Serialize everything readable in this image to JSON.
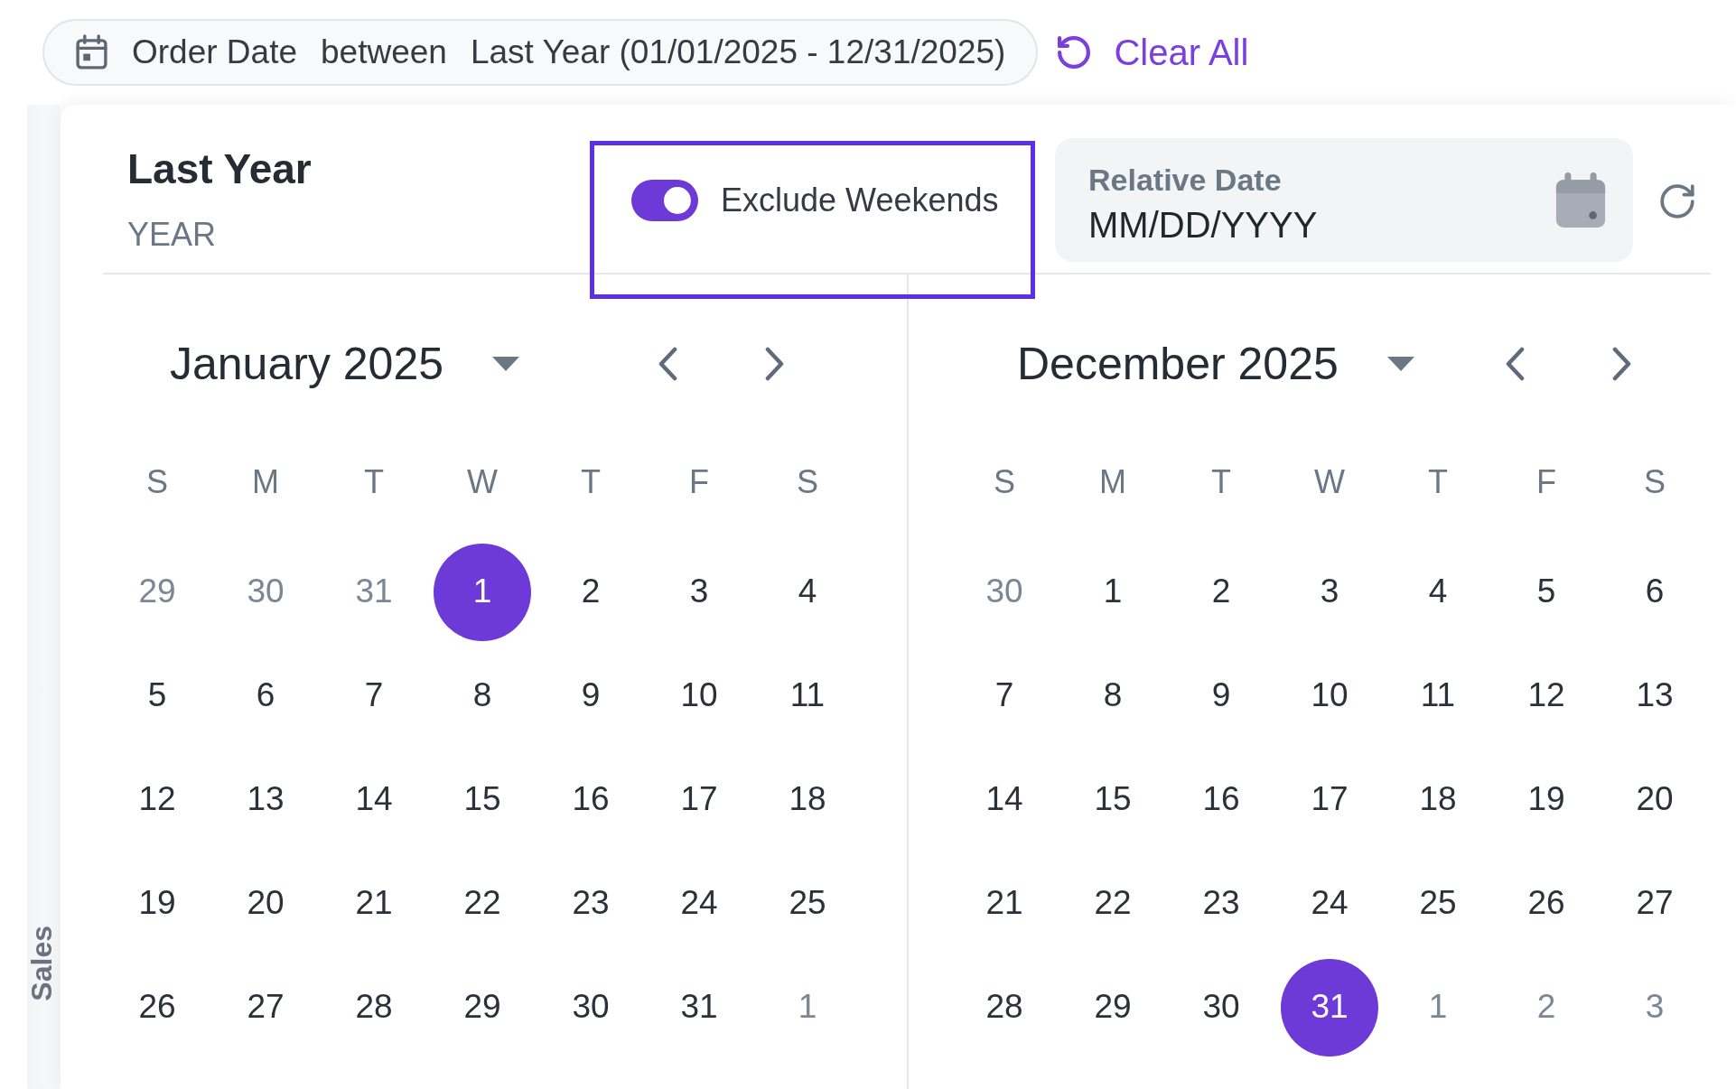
{
  "filter_chip": {
    "field": "Order Date",
    "operator": "between",
    "value": "Last Year (01/01/2025 - 12/31/2025)"
  },
  "clear_all": {
    "label": "Clear All"
  },
  "side_tab": {
    "label": "Sales"
  },
  "date_picker": {
    "preset": {
      "title": "Last Year",
      "unit": "YEAR"
    },
    "exclude_weekends": {
      "label": "Exclude Weekends",
      "on": true,
      "highlighted": true
    },
    "relative_date": {
      "label": "Relative Date",
      "placeholder": "MM/DD/YYYY"
    },
    "months": [
      {
        "title": "January 2025",
        "weekdays": [
          "S",
          "M",
          "T",
          "W",
          "T",
          "F",
          "S"
        ],
        "weeks": [
          [
            {
              "label": "29",
              "outside": true,
              "selected": false
            },
            {
              "label": "30",
              "outside": true,
              "selected": false
            },
            {
              "label": "31",
              "outside": true,
              "selected": false
            },
            {
              "label": "1",
              "outside": false,
              "selected": true
            },
            {
              "label": "2",
              "outside": false,
              "selected": false
            },
            {
              "label": "3",
              "outside": false,
              "selected": false
            },
            {
              "label": "4",
              "outside": false,
              "selected": false
            }
          ],
          [
            {
              "label": "5",
              "outside": false,
              "selected": false
            },
            {
              "label": "6",
              "outside": false,
              "selected": false
            },
            {
              "label": "7",
              "outside": false,
              "selected": false
            },
            {
              "label": "8",
              "outside": false,
              "selected": false
            },
            {
              "label": "9",
              "outside": false,
              "selected": false
            },
            {
              "label": "10",
              "outside": false,
              "selected": false
            },
            {
              "label": "11",
              "outside": false,
              "selected": false
            }
          ],
          [
            {
              "label": "12",
              "outside": false,
              "selected": false
            },
            {
              "label": "13",
              "outside": false,
              "selected": false
            },
            {
              "label": "14",
              "outside": false,
              "selected": false
            },
            {
              "label": "15",
              "outside": false,
              "selected": false
            },
            {
              "label": "16",
              "outside": false,
              "selected": false
            },
            {
              "label": "17",
              "outside": false,
              "selected": false
            },
            {
              "label": "18",
              "outside": false,
              "selected": false
            }
          ],
          [
            {
              "label": "19",
              "outside": false,
              "selected": false
            },
            {
              "label": "20",
              "outside": false,
              "selected": false
            },
            {
              "label": "21",
              "outside": false,
              "selected": false
            },
            {
              "label": "22",
              "outside": false,
              "selected": false
            },
            {
              "label": "23",
              "outside": false,
              "selected": false
            },
            {
              "label": "24",
              "outside": false,
              "selected": false
            },
            {
              "label": "25",
              "outside": false,
              "selected": false
            }
          ],
          [
            {
              "label": "26",
              "outside": false,
              "selected": false
            },
            {
              "label": "27",
              "outside": false,
              "selected": false
            },
            {
              "label": "28",
              "outside": false,
              "selected": false
            },
            {
              "label": "29",
              "outside": false,
              "selected": false
            },
            {
              "label": "30",
              "outside": false,
              "selected": false
            },
            {
              "label": "31",
              "outside": false,
              "selected": false
            },
            {
              "label": "1",
              "outside": true,
              "selected": false
            }
          ]
        ]
      },
      {
        "title": "December 2025",
        "weekdays": [
          "S",
          "M",
          "T",
          "W",
          "T",
          "F",
          "S"
        ],
        "weeks": [
          [
            {
              "label": "30",
              "outside": true,
              "selected": false
            },
            {
              "label": "1",
              "outside": false,
              "selected": false
            },
            {
              "label": "2",
              "outside": false,
              "selected": false
            },
            {
              "label": "3",
              "outside": false,
              "selected": false
            },
            {
              "label": "4",
              "outside": false,
              "selected": false
            },
            {
              "label": "5",
              "outside": false,
              "selected": false
            },
            {
              "label": "6",
              "outside": false,
              "selected": false
            }
          ],
          [
            {
              "label": "7",
              "outside": false,
              "selected": false
            },
            {
              "label": "8",
              "outside": false,
              "selected": false
            },
            {
              "label": "9",
              "outside": false,
              "selected": false
            },
            {
              "label": "10",
              "outside": false,
              "selected": false
            },
            {
              "label": "11",
              "outside": false,
              "selected": false
            },
            {
              "label": "12",
              "outside": false,
              "selected": false
            },
            {
              "label": "13",
              "outside": false,
              "selected": false
            }
          ],
          [
            {
              "label": "14",
              "outside": false,
              "selected": false
            },
            {
              "label": "15",
              "outside": false,
              "selected": false
            },
            {
              "label": "16",
              "outside": false,
              "selected": false
            },
            {
              "label": "17",
              "outside": false,
              "selected": false
            },
            {
              "label": "18",
              "outside": false,
              "selected": false
            },
            {
              "label": "19",
              "outside": false,
              "selected": false
            },
            {
              "label": "20",
              "outside": false,
              "selected": false
            }
          ],
          [
            {
              "label": "21",
              "outside": false,
              "selected": false
            },
            {
              "label": "22",
              "outside": false,
              "selected": false
            },
            {
              "label": "23",
              "outside": false,
              "selected": false
            },
            {
              "label": "24",
              "outside": false,
              "selected": false
            },
            {
              "label": "25",
              "outside": false,
              "selected": false
            },
            {
              "label": "26",
              "outside": false,
              "selected": false
            },
            {
              "label": "27",
              "outside": false,
              "selected": false
            }
          ],
          [
            {
              "label": "28",
              "outside": false,
              "selected": false
            },
            {
              "label": "29",
              "outside": false,
              "selected": false
            },
            {
              "label": "30",
              "outside": false,
              "selected": false
            },
            {
              "label": "31",
              "outside": false,
              "selected": true
            },
            {
              "label": "1",
              "outside": true,
              "selected": false
            },
            {
              "label": "2",
              "outside": true,
              "selected": false
            },
            {
              "label": "3",
              "outside": true,
              "selected": false
            }
          ]
        ]
      }
    ]
  }
}
